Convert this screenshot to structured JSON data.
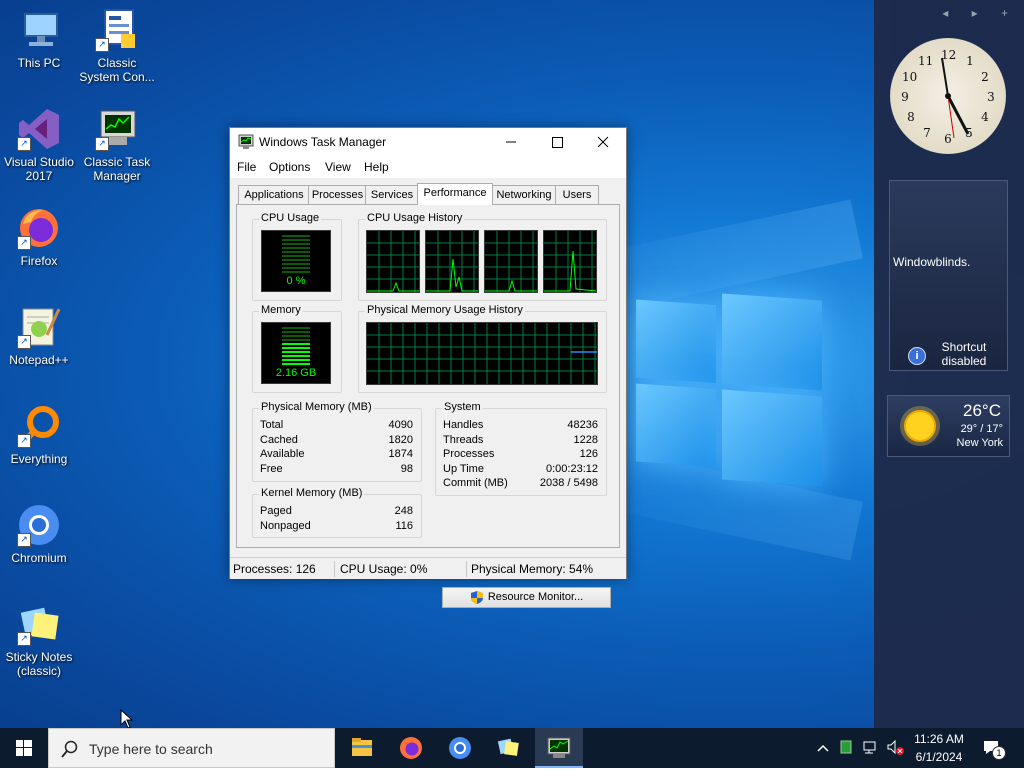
{
  "desktop": {
    "icons": [
      {
        "label": "This PC"
      },
      {
        "label": "Classic System Con..."
      },
      {
        "label": "Visual Studio 2017"
      },
      {
        "label": "Classic Task Manager"
      },
      {
        "label": "Firefox"
      },
      {
        "label": "Notepad++"
      },
      {
        "label": "Everything"
      },
      {
        "label": "Chromium"
      },
      {
        "label": "Sticky Notes (classic)"
      }
    ]
  },
  "sidebar": {
    "nav": "◂ ▸ +",
    "clock": {
      "numbers": [
        "12",
        "1",
        "2",
        "3",
        "4",
        "5",
        "6",
        "7",
        "8",
        "9",
        "10",
        "11"
      ]
    },
    "gadget_text": "Windowblinds.",
    "shortcut_label": "Shortcut disabled",
    "weather": {
      "temp": "26°C",
      "range": "29° / 17°",
      "city": "New York"
    }
  },
  "taskmanager": {
    "title": "Windows Task Manager",
    "menu": [
      "File",
      "Options",
      "View",
      "Help"
    ],
    "tabs": [
      "Applications",
      "Processes",
      "Services",
      "Performance",
      "Networking",
      "Users"
    ],
    "active_tab": "Performance",
    "cpu_usage_label": "CPU Usage",
    "cpu_usage_value": "0 %",
    "cpu_history_label": "CPU Usage History",
    "memory_label": "Memory",
    "memory_value": "2.16 GB",
    "mem_history_label": "Physical Memory Usage History",
    "physical": {
      "label": "Physical Memory (MB)",
      "rows": [
        {
          "k": "Total",
          "v": "4090"
        },
        {
          "k": "Cached",
          "v": "1820"
        },
        {
          "k": "Available",
          "v": "1874"
        },
        {
          "k": "Free",
          "v": "98"
        }
      ]
    },
    "kernel": {
      "label": "Kernel Memory (MB)",
      "rows": [
        {
          "k": "Paged",
          "v": "248"
        },
        {
          "k": "Nonpaged",
          "v": "116"
        }
      ]
    },
    "system": {
      "label": "System",
      "rows": [
        {
          "k": "Handles",
          "v": "48236"
        },
        {
          "k": "Threads",
          "v": "1228"
        },
        {
          "k": "Processes",
          "v": "126"
        },
        {
          "k": "Up Time",
          "v": "0:00:23:12"
        },
        {
          "k": "Commit (MB)",
          "v": "2038 / 5498"
        }
      ]
    },
    "resource_button": "Resource Monitor...",
    "status": {
      "processes": "Processes: 126",
      "cpu": "CPU Usage: 0%",
      "memory": "Physical Memory: 54%"
    }
  },
  "taskbar": {
    "search_placeholder": "Type here to search",
    "time": "11:26 AM",
    "date": "6/1/2024",
    "notification_count": "1"
  },
  "colors": {
    "graph_green": "#00ff00",
    "grid_green": "#008040",
    "mem_line": "#2a8cff"
  }
}
